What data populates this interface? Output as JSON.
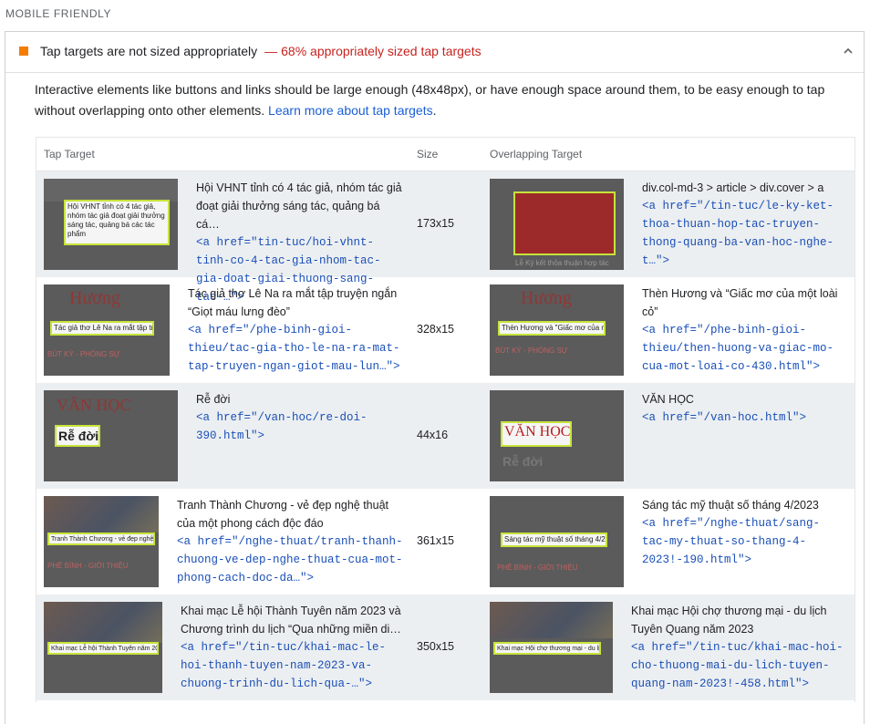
{
  "section_title": "MOBILE FRIENDLY",
  "audit": {
    "title": "Tap targets are not sized appropriately",
    "dash": "—",
    "display_value": "68% appropriately sized tap targets",
    "status_color": "#f57c00",
    "description": "Interactive elements like buttons and links should be large enough (48x48px), or have enough space around them, to be easy enough to tap without overlapping onto other elements. ",
    "learn_more": "Learn more about tap targets",
    "period": "."
  },
  "table": {
    "headers": [
      "Tap Target",
      "Size",
      "Overlapping Target"
    ],
    "rows": [
      {
        "target_label": "Hội VHNT tỉnh có 4 tác giả, nhóm tác giả đoạt giải thưởng sáng tác, quảng bá cá…",
        "target_code": "<a href=\"tin-tuc/hoi-vhnt-tinh-co-4-tac-gia-nhom-tac-gia-doat-giai-thuong-sang-tac-…\">",
        "target_thumb_text": "Hội VHNT tỉnh có 4 tác giả, nhóm tác giả đoạt giải thưởng sáng tác, quảng bá các tác phẩm",
        "size": "173x15",
        "overlap_label": "div.col-md-3 > article > div.cover > a",
        "overlap_code": "<a href=\"/tin-tuc/le-ky-ket-thoa-thuan-hop-tac-truyen-thong-quang-ba-van-hoc-nghe-t…\">",
        "overlap_thumb_text": "Lễ Ký kết thỏa thuận hợp tác"
      },
      {
        "target_label": "Tác giả thơ Lê Na ra mắt tập truyện ngắn “Giọt máu lưng đèo”",
        "target_code": "<a href=\"/phe-binh-gioi-thieu/tac-gia-tho-le-na-ra-mat-tap-truyen-ngan-giot-mau-lun…\">",
        "target_thumb_text": "Tác giả thơ Lê Na ra mắt tập truyện ngắn \"Giọt máu lưng đèo\"",
        "size": "328x15",
        "overlap_label": "Thèn Hương và “Giấc mơ của một loài cỏ”",
        "overlap_code": "<a href=\"/phe-binh-gioi-thieu/then-huong-va-giac-mo-cua-mot-loai-co-430.html\">",
        "overlap_thumb_text": "Thèn Hương và \"Giấc mơ của một loài cỏ\""
      },
      {
        "target_label": "Rễ đời",
        "target_code": "<a href=\"/van-hoc/re-doi-390.html\">",
        "target_thumb_text": "Rễ đời",
        "size": "44x16",
        "overlap_label": "VĂN HỌC",
        "overlap_code": "<a href=\"/van-hoc.html\">",
        "overlap_thumb_text": "VĂN HỌC"
      },
      {
        "target_label": "Tranh Thành Chương - vẻ đẹp nghệ thuật của một phong cách độc đáo",
        "target_code": "<a href=\"/nghe-thuat/tranh-thanh-chuong-ve-dep-nghe-thuat-cua-mot-phong-cach-doc-da…\">",
        "target_thumb_text": "Tranh Thành Chương - vẻ đẹp nghệ thuật của một phong cách độc đáo",
        "size": "361x15",
        "overlap_label": "Sáng tác mỹ thuật số tháng 4/2023",
        "overlap_code": "<a href=\"/nghe-thuat/sang-tac-my-thuat-so-thang-4-2023!-190.html\">",
        "overlap_thumb_text": "Sáng tác mỹ thuật số tháng 4/2023"
      },
      {
        "target_label": "Khai mạc Lễ hội Thành Tuyên năm 2023 và Chương trình du lịch “Qua những miền di…",
        "target_code": "<a href=\"/tin-tuc/khai-mac-le-hoi-thanh-tuyen-nam-2023-va-chuong-trinh-du-lich-qua-…\">",
        "target_thumb_text": "Khai mạc Lễ hội Thành Tuyên năm 2023",
        "size": "350x15",
        "overlap_label": "Khai mạc Hội chợ thương mại - du lịch Tuyên Quang năm 2023",
        "overlap_code": "<a href=\"/tin-tuc/khai-mac-hoi-cho-thuong-mai-du-lich-tuyen-quang-nam-2023!-458.html\">",
        "overlap_thumb_text": "Khai mạc Hội chợ thương mại - du lịch Tuyên Quang năm 2023"
      }
    ]
  },
  "thumb_labels": {
    "van_hoc": "VĂN HỌC",
    "re_doi": "Rễ đời",
    "but_ky": "BÚT KÝ - PHÓNG SỰ",
    "phe_binh": "PHÊ BÌNH - GIỚI THIỆU"
  }
}
